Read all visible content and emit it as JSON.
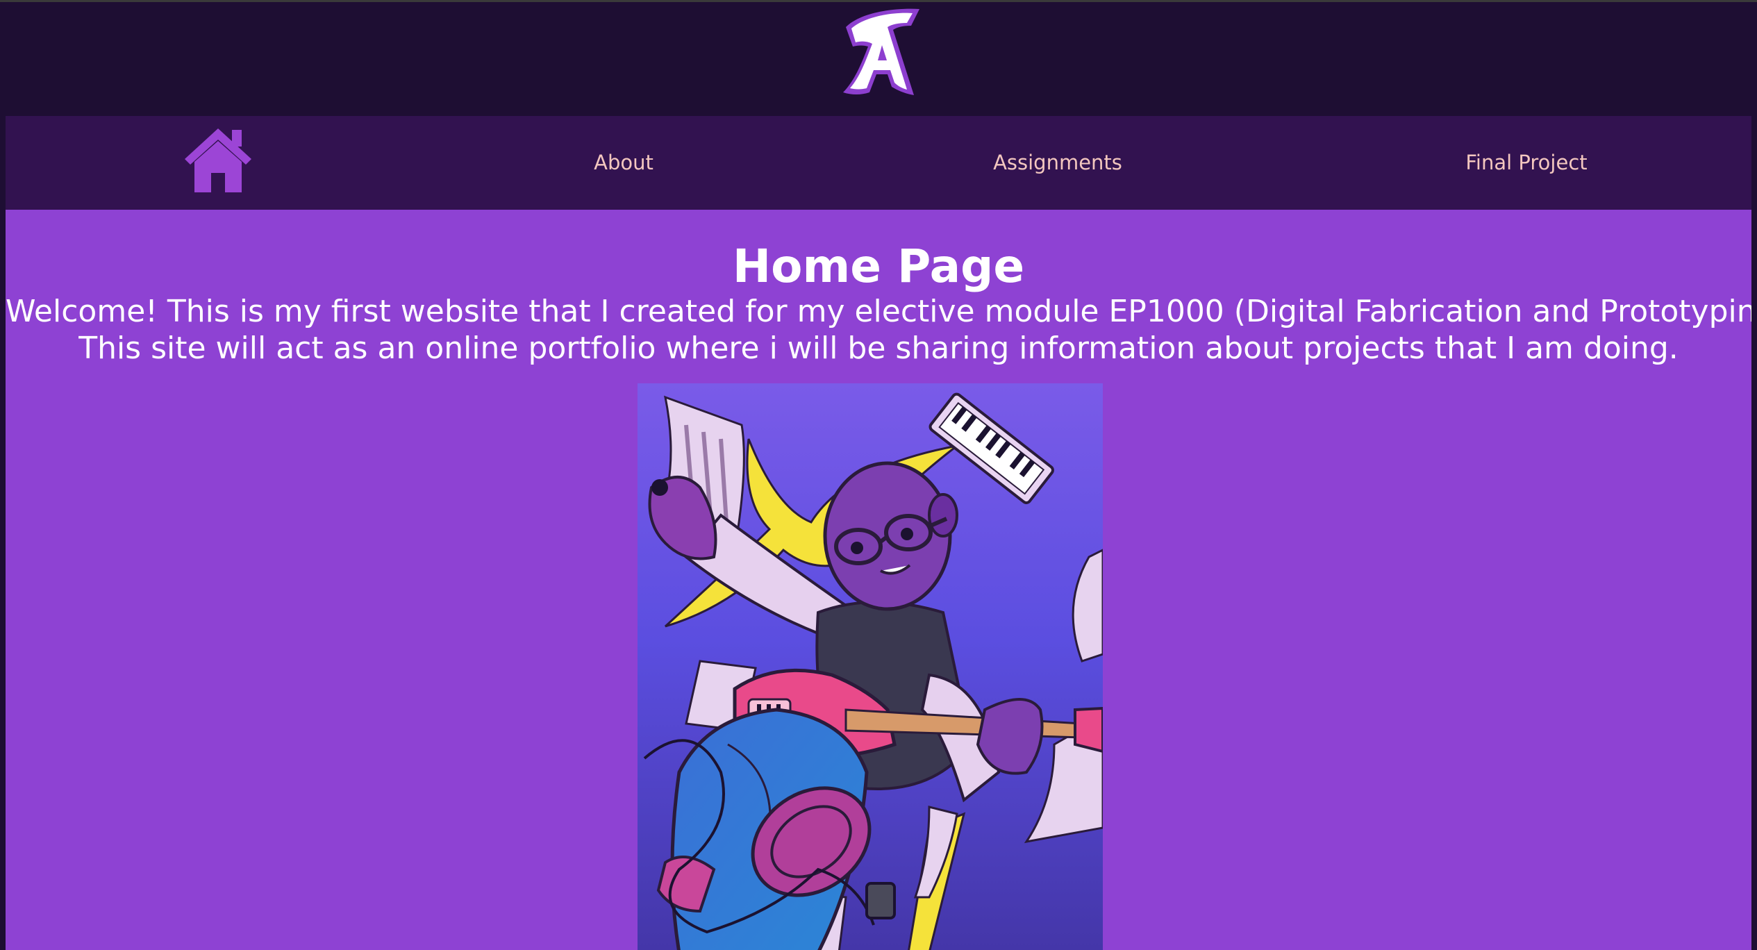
{
  "header": {
    "logo_text": "TA",
    "logo_icon": "ta-monogram-logo"
  },
  "nav": {
    "home_icon": "house-icon",
    "items": [
      {
        "label": "About"
      },
      {
        "label": "Assignments"
      },
      {
        "label": "Final Project"
      }
    ]
  },
  "main": {
    "title": "Home Page",
    "intro_lines": [
      "Welcome! This is my first website that I created for my elective module EP1000 (Digital Fabrication and Prototyping).",
      "This site will act as an online portfolio where i will be sharing information about projects that I am doing."
    ],
    "hero_image": "illustrated-guitarist-portrait"
  },
  "colors": {
    "header_bg": "#1e0e33",
    "nav_bg": "#321250",
    "nav_text": "#f3c7bf",
    "content_bg": "#8e42d3",
    "home_icon": "#9c45d6",
    "text": "#ffffff"
  }
}
